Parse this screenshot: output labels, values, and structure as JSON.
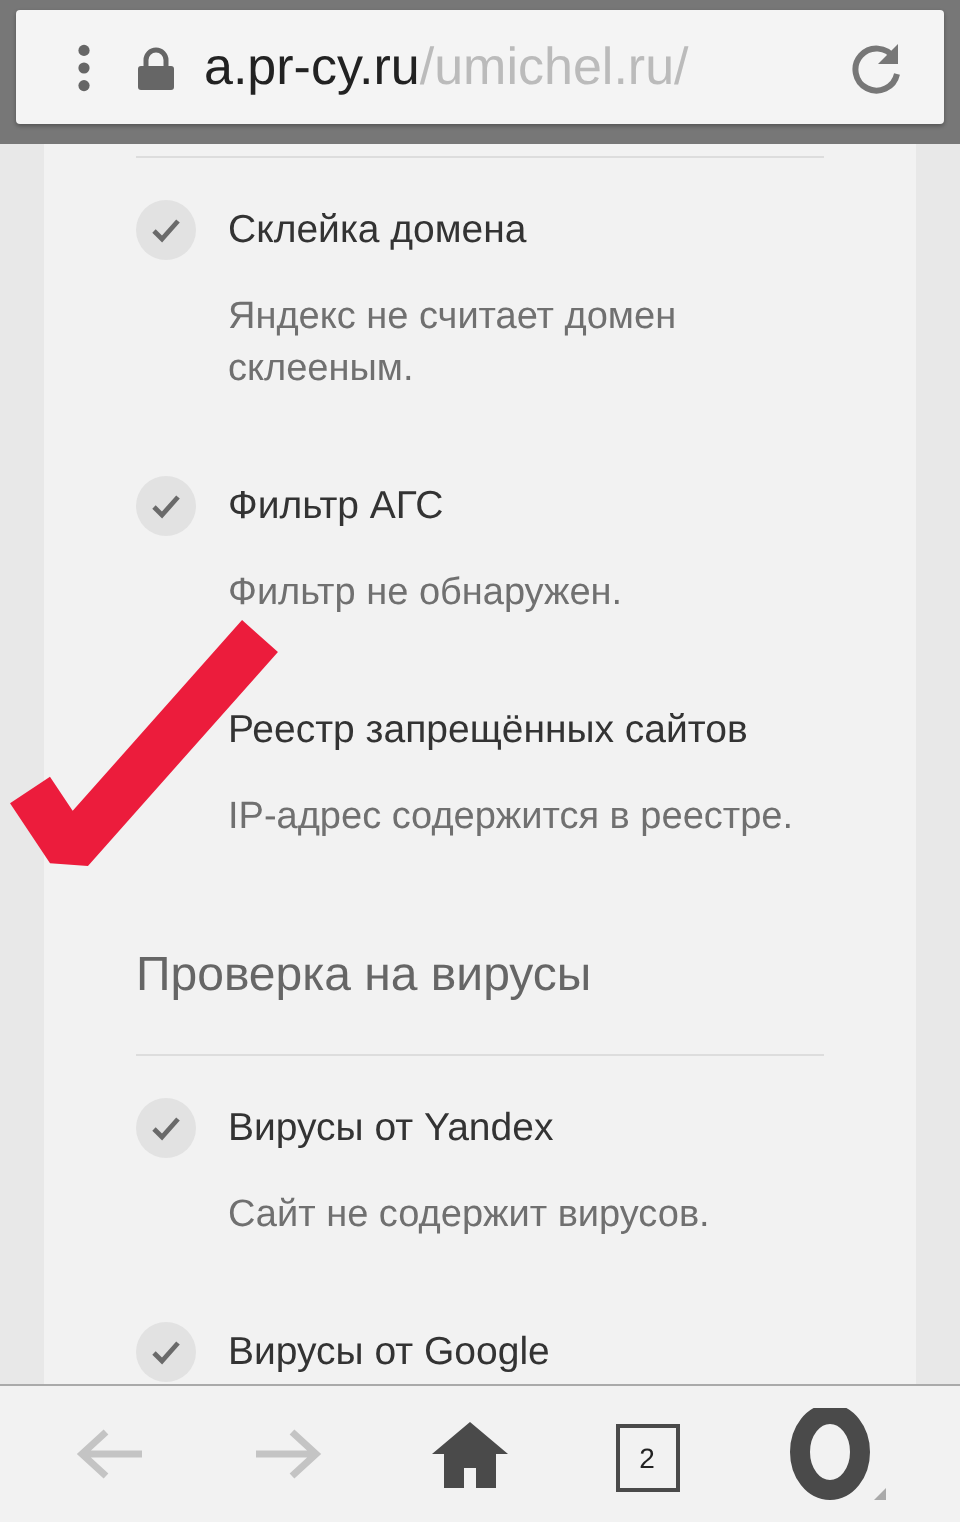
{
  "address_bar": {
    "domain": "a.pr-cy.ru",
    "path": "/umichel.ru/"
  },
  "checks": [
    {
      "title": "Склейка домена",
      "description": "Яндекс не считает домен склееным."
    },
    {
      "title": "Фильтр АГС",
      "description": "Фильтр не обнаружен."
    },
    {
      "title": "Реестр запрещённых сайтов",
      "description": "IP-адрес содержится в реестре."
    }
  ],
  "virus_section": {
    "heading": "Проверка на вирусы",
    "checks": [
      {
        "title": "Вирусы от Yandex",
        "description": "Сайт не содержит вирусов."
      },
      {
        "title": "Вирусы от Google"
      }
    ]
  },
  "toolbar": {
    "back_disabled": true,
    "forward_disabled": true,
    "tab_count": "2"
  }
}
